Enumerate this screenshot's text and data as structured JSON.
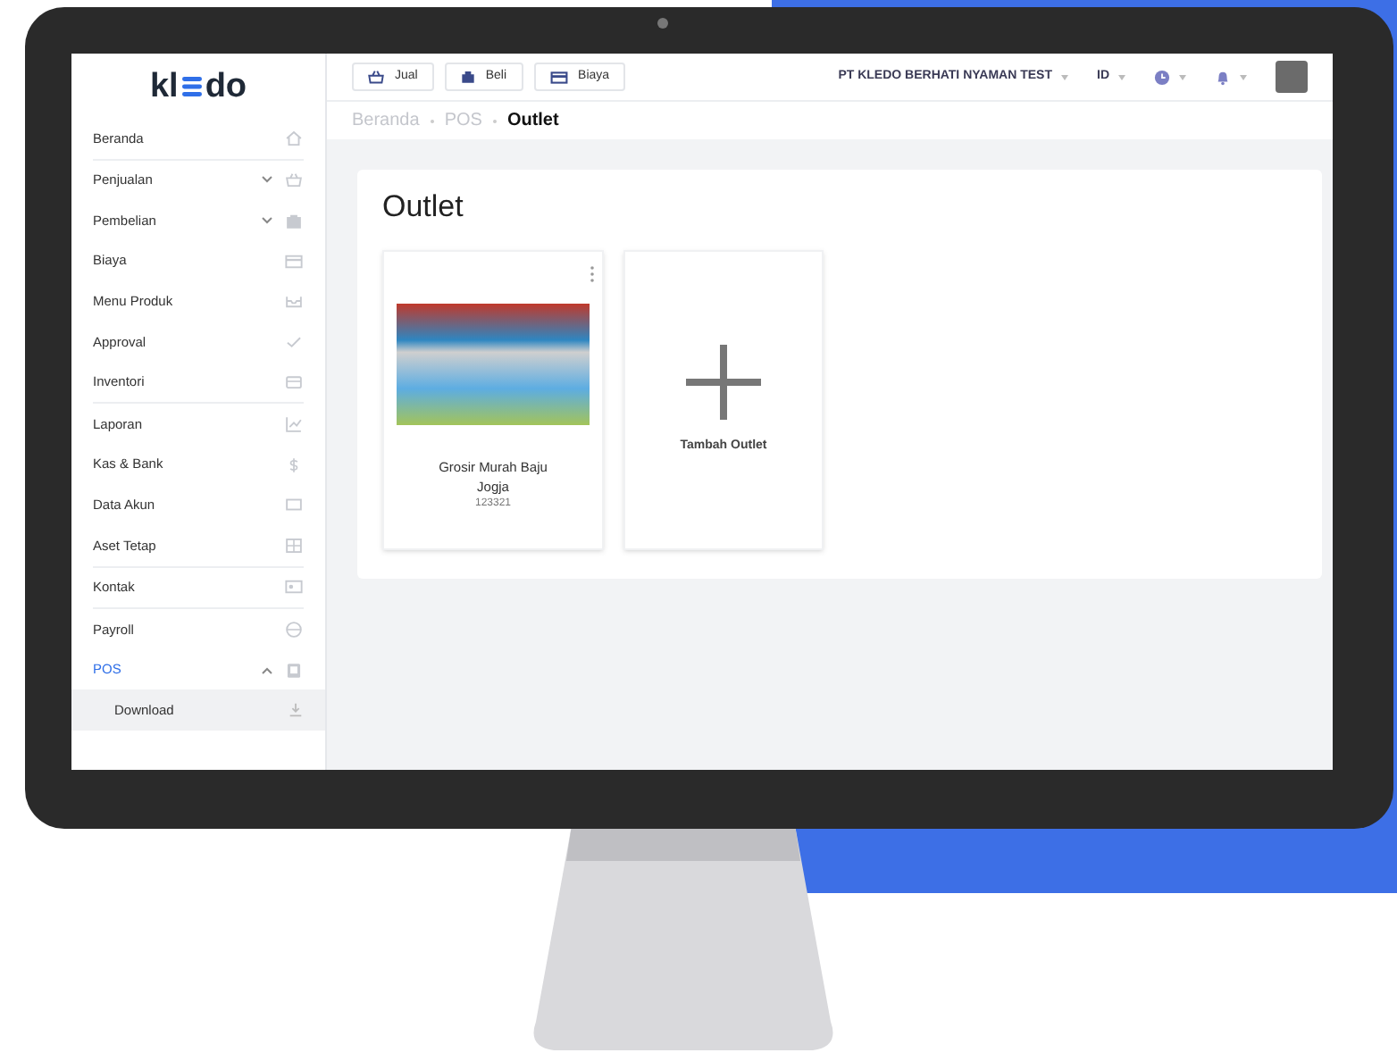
{
  "logo": {
    "text_before": "kl",
    "text_after": "do"
  },
  "sidebar": {
    "items": [
      {
        "label": "Beranda",
        "kind": "link",
        "selected": false,
        "divider_after": true
      },
      {
        "label": "Penjualan",
        "kind": "group",
        "selected": false,
        "expanded": false
      },
      {
        "label": "Pembelian",
        "kind": "group",
        "selected": false,
        "expanded": false
      },
      {
        "label": "Biaya",
        "kind": "link",
        "selected": false
      },
      {
        "label": "Menu Produk",
        "kind": "link",
        "selected": false
      },
      {
        "label": "Approval",
        "kind": "link",
        "selected": false
      },
      {
        "label": "Inventori",
        "kind": "link",
        "selected": false,
        "divider_after": true
      },
      {
        "label": "Laporan",
        "kind": "link",
        "selected": false
      },
      {
        "label": "Kas & Bank",
        "kind": "link",
        "selected": false
      },
      {
        "label": "Data Akun",
        "kind": "link",
        "selected": false
      },
      {
        "label": "Aset Tetap",
        "kind": "link",
        "selected": false,
        "divider_after": true
      },
      {
        "label": "Kontak",
        "kind": "link",
        "selected": false,
        "divider_after": true
      },
      {
        "label": "Payroll",
        "kind": "link",
        "selected": false
      },
      {
        "label": "POS",
        "kind": "group",
        "selected": true,
        "expanded": true,
        "children": [
          {
            "label": "Download",
            "selected": true
          }
        ]
      }
    ]
  },
  "topbar": {
    "buttons": [
      "Jual",
      "Beli",
      "Biaya"
    ],
    "company": "PT KLEDO BERHATI NYAMAN TEST",
    "language": "ID"
  },
  "breadcrumb": [
    {
      "label": "Beranda",
      "current": false
    },
    {
      "label": "POS",
      "current": false
    },
    {
      "label": "Outlet",
      "current": true
    }
  ],
  "page": {
    "title": "Outlet",
    "outlets": [
      {
        "name": "Grosir Murah Baju Jogja",
        "code": "123321"
      }
    ],
    "add_label": "Tambah Outlet"
  }
}
